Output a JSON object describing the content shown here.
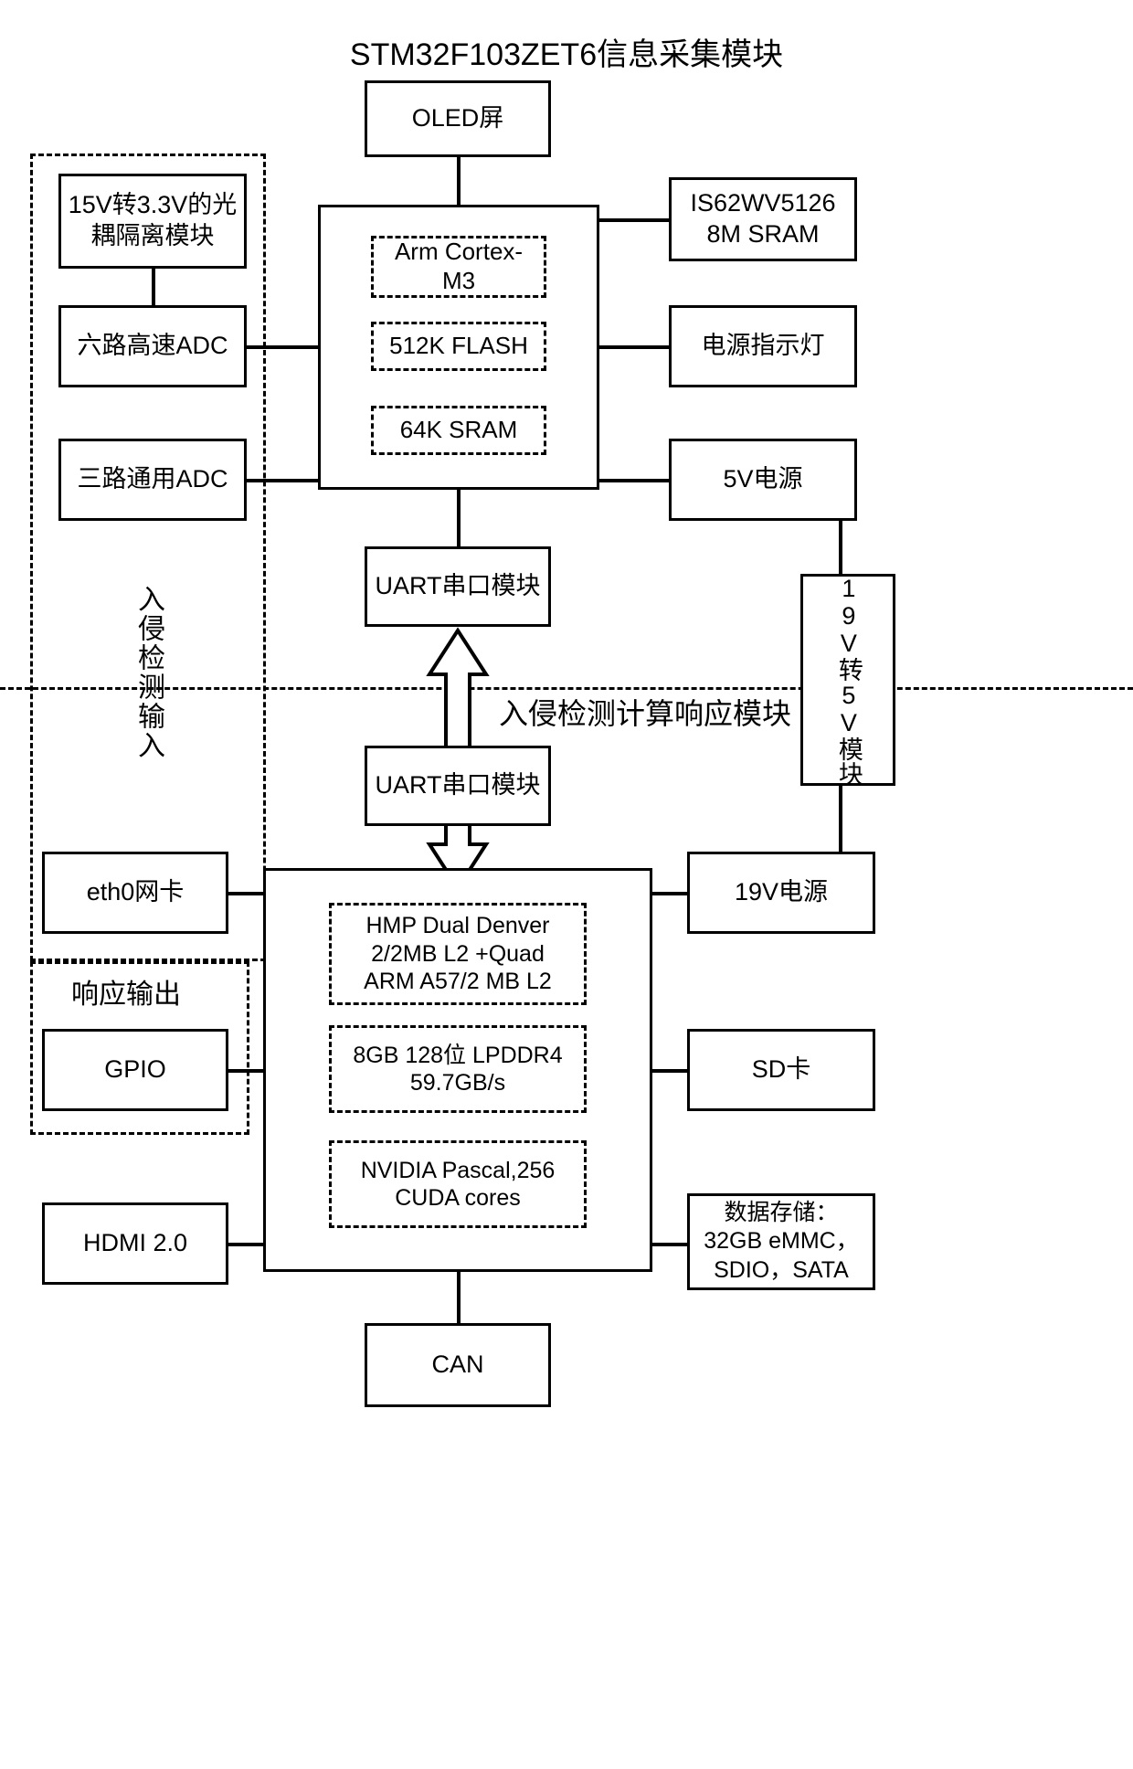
{
  "diagram": {
    "title": "STM32F103ZET6信息采集模块",
    "center_label": "入侵检测计算响应模块",
    "region_labels": {
      "intrusion_input": "入侵检测输入",
      "response_output": "响应输出"
    },
    "blocks": {
      "oled": "OLED屏",
      "opto_isolation": "15V转3.3V的光\n耦隔离模块",
      "opto_isolation_line1": "15V转3.3V的光",
      "opto_isolation_line2": "耦隔离模块",
      "adc_highspeed": "六路高速ADC",
      "adc_general": "三路通用ADC",
      "sram_ext_line1": "IS62WV5126",
      "sram_ext_line2": "8M SRAM",
      "power_led": "电源指示灯",
      "power_5v": "5V电源",
      "conv_19v_5v": "19V转5V模块",
      "uart_top": "UART串口模块",
      "uart_bottom": "UART串口模块",
      "eth0": "eth0网卡",
      "gpio": "GPIO",
      "hdmi": "HDMI 2.0",
      "can": "CAN",
      "power_19v": "19V电源",
      "sd_card": "SD卡",
      "storage_line1": "数据存储：",
      "storage_line2": "32GB eMMC，",
      "storage_line3": "SDIO，SATA"
    },
    "mcu_internals": [
      {
        "line1": "Arm Cortex-",
        "line2": "M3"
      },
      {
        "line1": "512K FLASH",
        "line2": ""
      },
      {
        "line1": "64K SRAM",
        "line2": ""
      }
    ],
    "soc_internals": [
      {
        "line1": "HMP Dual Denver",
        "line2": "2/2MB L2 +Quad",
        "line3": "ARM A57/2 MB L2"
      },
      {
        "line1": "8GB 128位 LPDDR4",
        "line2": "59.7GB/s",
        "line3": ""
      },
      {
        "line1": "NVIDIA Pascal,256",
        "line2": "CUDA cores",
        "line3": ""
      }
    ],
    "colors": {
      "stroke": "#000000",
      "background": "#ffffff"
    }
  }
}
